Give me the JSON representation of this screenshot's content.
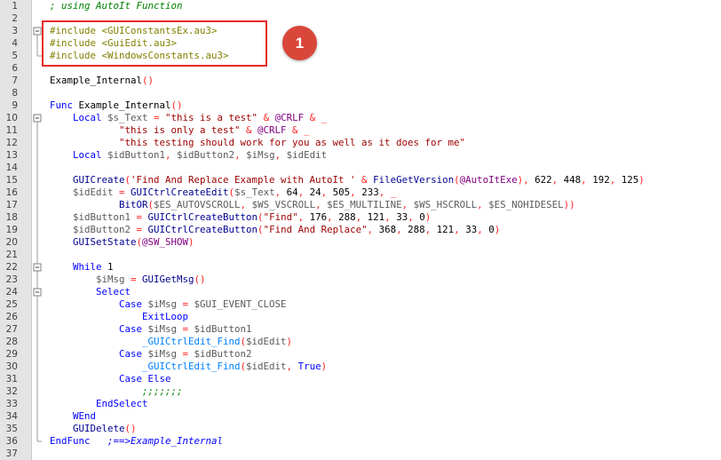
{
  "badge": "1",
  "fold_markers": {
    "3": "⊟",
    "10": "⊟",
    "22": "⊟",
    "24": "⊟"
  },
  "lines": [
    [
      {
        "t": "; using AutoIt Function",
        "c": "c"
      }
    ],
    [],
    [
      {
        "t": "#include <GUIConstantsEx.au3>",
        "c": "inc"
      }
    ],
    [
      {
        "t": "#include <GuiEdit.au3>",
        "c": "inc"
      }
    ],
    [
      {
        "t": "#include <WindowsConstants.au3>",
        "c": "inc"
      }
    ],
    [],
    [
      {
        "t": "Example_Internal",
        "c": "n"
      },
      {
        "t": "()",
        "c": "p"
      }
    ],
    [],
    [
      {
        "t": "Func ",
        "c": "k"
      },
      {
        "t": "Example_Internal",
        "c": "n"
      },
      {
        "t": "()",
        "c": "p"
      }
    ],
    [
      {
        "t": "    Local ",
        "c": "k"
      },
      {
        "t": "$s_Text",
        "c": "v"
      },
      {
        "t": " = ",
        "c": "p"
      },
      {
        "t": "\"this is a test\"",
        "c": "s"
      },
      {
        "t": " & ",
        "c": "p"
      },
      {
        "t": "@CRLF",
        "c": "m"
      },
      {
        "t": " & _",
        "c": "p"
      }
    ],
    [
      {
        "t": "            \"this is only a test\"",
        "c": "s"
      },
      {
        "t": " & ",
        "c": "p"
      },
      {
        "t": "@CRLF",
        "c": "m"
      },
      {
        "t": " & _",
        "c": "p"
      }
    ],
    [
      {
        "t": "            \"this testing should work for you as well as it does for me\"",
        "c": "s"
      }
    ],
    [
      {
        "t": "    Local ",
        "c": "k"
      },
      {
        "t": "$idButton1",
        "c": "v"
      },
      {
        "t": ", ",
        "c": "p"
      },
      {
        "t": "$idButton2",
        "c": "v"
      },
      {
        "t": ", ",
        "c": "p"
      },
      {
        "t": "$iMsg",
        "c": "v"
      },
      {
        "t": ", ",
        "c": "p"
      },
      {
        "t": "$idEdit",
        "c": "v"
      }
    ],
    [],
    [
      {
        "t": "    GUICreate",
        "c": "f"
      },
      {
        "t": "(",
        "c": "p"
      },
      {
        "t": "'Find And Replace Example with AutoIt '",
        "c": "s"
      },
      {
        "t": " & ",
        "c": "p"
      },
      {
        "t": "FileGetVersion",
        "c": "f"
      },
      {
        "t": "(",
        "c": "p"
      },
      {
        "t": "@AutoItExe",
        "c": "m"
      },
      {
        "t": "), ",
        "c": "p"
      },
      {
        "t": "622",
        "c": "n"
      },
      {
        "t": ", ",
        "c": "p"
      },
      {
        "t": "448",
        "c": "n"
      },
      {
        "t": ", ",
        "c": "p"
      },
      {
        "t": "192",
        "c": "n"
      },
      {
        "t": ", ",
        "c": "p"
      },
      {
        "t": "125",
        "c": "n"
      },
      {
        "t": ")",
        "c": "p"
      }
    ],
    [
      {
        "t": "    $idEdit",
        "c": "v"
      },
      {
        "t": " = ",
        "c": "p"
      },
      {
        "t": "GUICtrlCreateEdit",
        "c": "f"
      },
      {
        "t": "(",
        "c": "p"
      },
      {
        "t": "$s_Text",
        "c": "v"
      },
      {
        "t": ", ",
        "c": "p"
      },
      {
        "t": "64",
        "c": "n"
      },
      {
        "t": ", ",
        "c": "p"
      },
      {
        "t": "24",
        "c": "n"
      },
      {
        "t": ", ",
        "c": "p"
      },
      {
        "t": "505",
        "c": "n"
      },
      {
        "t": ", ",
        "c": "p"
      },
      {
        "t": "233",
        "c": "n"
      },
      {
        "t": ", _",
        "c": "p"
      }
    ],
    [
      {
        "t": "            BitOR",
        "c": "f"
      },
      {
        "t": "(",
        "c": "p"
      },
      {
        "t": "$ES_AUTOVSCROLL",
        "c": "v"
      },
      {
        "t": ", ",
        "c": "p"
      },
      {
        "t": "$WS_VSCROLL",
        "c": "v"
      },
      {
        "t": ", ",
        "c": "p"
      },
      {
        "t": "$ES_MULTILINE",
        "c": "v"
      },
      {
        "t": ", ",
        "c": "p"
      },
      {
        "t": "$WS_HSCROLL",
        "c": "v"
      },
      {
        "t": ", ",
        "c": "p"
      },
      {
        "t": "$ES_NOHIDESEL",
        "c": "v"
      },
      {
        "t": "))",
        "c": "p"
      }
    ],
    [
      {
        "t": "    $idButton1",
        "c": "v"
      },
      {
        "t": " = ",
        "c": "p"
      },
      {
        "t": "GUICtrlCreateButton",
        "c": "f"
      },
      {
        "t": "(",
        "c": "p"
      },
      {
        "t": "\"Find\"",
        "c": "s"
      },
      {
        "t": ", ",
        "c": "p"
      },
      {
        "t": "176",
        "c": "n"
      },
      {
        "t": ", ",
        "c": "p"
      },
      {
        "t": "288",
        "c": "n"
      },
      {
        "t": ", ",
        "c": "p"
      },
      {
        "t": "121",
        "c": "n"
      },
      {
        "t": ", ",
        "c": "p"
      },
      {
        "t": "33",
        "c": "n"
      },
      {
        "t": ", ",
        "c": "p"
      },
      {
        "t": "0",
        "c": "n"
      },
      {
        "t": ")",
        "c": "p"
      }
    ],
    [
      {
        "t": "    $idButton2",
        "c": "v"
      },
      {
        "t": " = ",
        "c": "p"
      },
      {
        "t": "GUICtrlCreateButton",
        "c": "f"
      },
      {
        "t": "(",
        "c": "p"
      },
      {
        "t": "\"Find And Replace\"",
        "c": "s"
      },
      {
        "t": ", ",
        "c": "p"
      },
      {
        "t": "368",
        "c": "n"
      },
      {
        "t": ", ",
        "c": "p"
      },
      {
        "t": "288",
        "c": "n"
      },
      {
        "t": ", ",
        "c": "p"
      },
      {
        "t": "121",
        "c": "n"
      },
      {
        "t": ", ",
        "c": "p"
      },
      {
        "t": "33",
        "c": "n"
      },
      {
        "t": ", ",
        "c": "p"
      },
      {
        "t": "0",
        "c": "n"
      },
      {
        "t": ")",
        "c": "p"
      }
    ],
    [
      {
        "t": "    GUISetState",
        "c": "f"
      },
      {
        "t": "(",
        "c": "p"
      },
      {
        "t": "@SW_SHOW",
        "c": "m"
      },
      {
        "t": ")",
        "c": "p"
      }
    ],
    [],
    [
      {
        "t": "    While ",
        "c": "k"
      },
      {
        "t": "1",
        "c": "n"
      }
    ],
    [
      {
        "t": "        $iMsg",
        "c": "v"
      },
      {
        "t": " = ",
        "c": "p"
      },
      {
        "t": "GUIGetMsg",
        "c": "f"
      },
      {
        "t": "()",
        "c": "p"
      }
    ],
    [
      {
        "t": "        Select",
        "c": "k"
      }
    ],
    [
      {
        "t": "            Case ",
        "c": "k"
      },
      {
        "t": "$iMsg",
        "c": "v"
      },
      {
        "t": " = ",
        "c": "p"
      },
      {
        "t": "$GUI_EVENT_CLOSE",
        "c": "v"
      }
    ],
    [
      {
        "t": "                ExitLoop",
        "c": "k"
      }
    ],
    [
      {
        "t": "            Case ",
        "c": "k"
      },
      {
        "t": "$iMsg",
        "c": "v"
      },
      {
        "t": " = ",
        "c": "p"
      },
      {
        "t": "$idButton1",
        "c": "v"
      }
    ],
    [
      {
        "t": "                _GUICtrlEdit_Find",
        "c": "b"
      },
      {
        "t": "(",
        "c": "p"
      },
      {
        "t": "$idEdit",
        "c": "v"
      },
      {
        "t": ")",
        "c": "p"
      }
    ],
    [
      {
        "t": "            Case ",
        "c": "k"
      },
      {
        "t": "$iMsg",
        "c": "v"
      },
      {
        "t": " = ",
        "c": "p"
      },
      {
        "t": "$idButton2",
        "c": "v"
      }
    ],
    [
      {
        "t": "                _GUICtrlEdit_Find",
        "c": "b"
      },
      {
        "t": "(",
        "c": "p"
      },
      {
        "t": "$idEdit",
        "c": "v"
      },
      {
        "t": ", ",
        "c": "p"
      },
      {
        "t": "True",
        "c": "k"
      },
      {
        "t": ")",
        "c": "p"
      }
    ],
    [
      {
        "t": "            Case Else",
        "c": "k"
      }
    ],
    [
      {
        "t": "                ;;;;;;;",
        "c": "c"
      }
    ],
    [
      {
        "t": "        EndSelect",
        "c": "k"
      }
    ],
    [
      {
        "t": "    WEnd",
        "c": "k"
      }
    ],
    [
      {
        "t": "    GUIDelete",
        "c": "f"
      },
      {
        "t": "()",
        "c": "p"
      }
    ],
    [
      {
        "t": "EndFunc",
        "c": "k"
      },
      {
        "t": "   ;==>Example_Internal",
        "c": "u"
      }
    ],
    []
  ]
}
